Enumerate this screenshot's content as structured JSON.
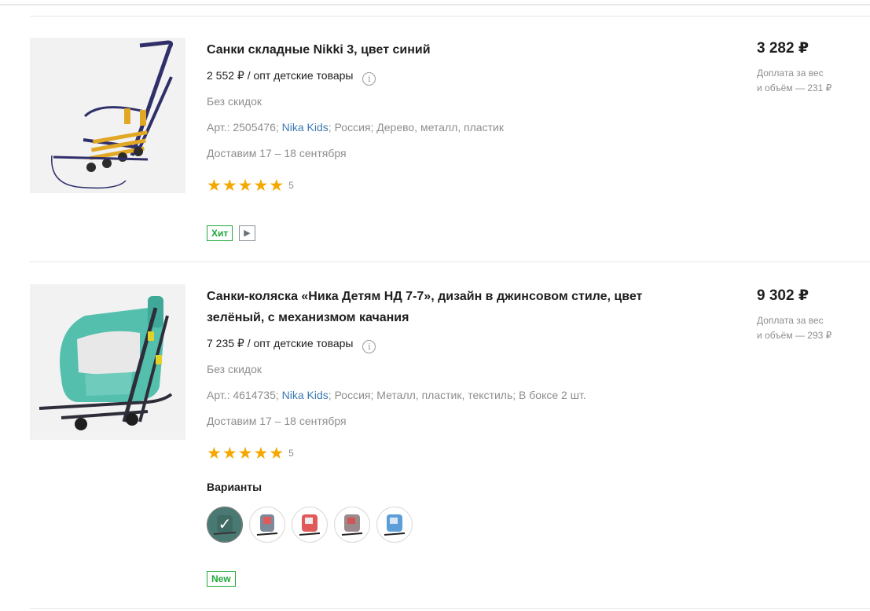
{
  "products": [
    {
      "title": "Санки складные Nikki 3, цвет синий",
      "wholesale": "2 552 ₽ / опт детские товары",
      "discount": "Без скидок",
      "article": "Арт.: 2505476;",
      "brand": "Nika Kids",
      "country": "Россия;",
      "materials": "Дерево, металл, пластик",
      "delivery": "Доставим 17 – 18 сентября",
      "rating_count": "5",
      "price": "3 282 ₽",
      "surcharge_line1": "Доплата за вес",
      "surcharge_line2": "и объём — 231 ₽",
      "badge": "Хит",
      "video_icon": "▶"
    },
    {
      "title": "Санки-коляска «Ника Детям НД 7-7», дизайн в джинсовом стиле, цвет зелёный, с механизмом качания",
      "wholesale": "7 235 ₽ / опт детские товары",
      "discount": "Без скидок",
      "article": "Арт.: 4614735;",
      "brand": "Nika Kids",
      "country": "Россия;",
      "materials": "Металл, пластик, текстиль;",
      "box": "В боксе 2 шт.",
      "delivery": "Доставим 17 – 18 сентября",
      "rating_count": "5",
      "price": "9 302 ₽",
      "surcharge_line1": "Доплата за вес",
      "surcharge_line2": "и объём — 293 ₽",
      "variants_label": "Варианты",
      "variants": [
        {
          "color": "#4fb8a8",
          "selected": true
        },
        {
          "color": "#7d8a9a",
          "selected": false
        },
        {
          "color": "#e05a5a",
          "selected": false
        },
        {
          "color": "#9b8a8c",
          "selected": false
        },
        {
          "color": "#5c9fd8",
          "selected": false
        }
      ],
      "badge": "New"
    }
  ],
  "colors": {
    "accent_green": "#1fa93a",
    "link_blue": "#3b78b3",
    "star": "#f5a800"
  },
  "icons": {
    "info": "info-icon",
    "star": "star-icon",
    "video": "play-icon",
    "check": "check-icon"
  }
}
